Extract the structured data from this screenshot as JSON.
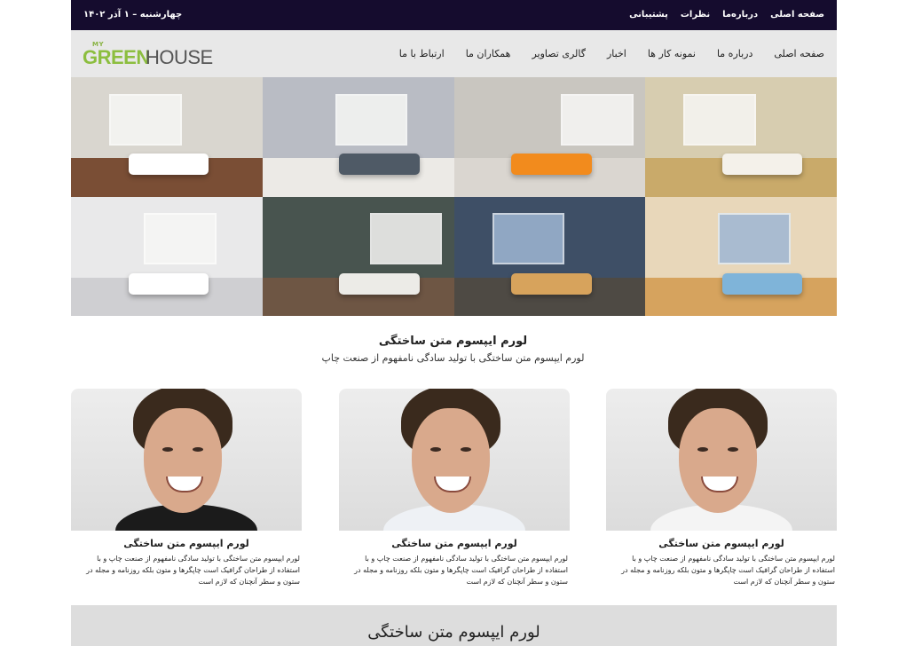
{
  "topbar": {
    "date": "چهارشنبه – ۱ آذر ۱۴۰۲",
    "links": [
      "صفحه اصلی",
      "درباره‌ما",
      "نظرات",
      "پشتیبانی"
    ]
  },
  "logo": {
    "my": "MY",
    "green": "GREEN",
    "house": "HOUSE"
  },
  "nav": [
    "صفحه اصلی",
    "درباره ما",
    "نمونه کار ها",
    "اخبار",
    "گالری تصاویر",
    "همکاران ما",
    "ارتباط با ما"
  ],
  "gallery": [
    {
      "name": "living-room-photo-1",
      "wall": "#d9d6cf",
      "floor": "#7a4e35",
      "accent": "#ffffff"
    },
    {
      "name": "living-room-photo-2",
      "wall": "#b9bcc4",
      "floor": "#eceae6",
      "accent": "#4f5a66"
    },
    {
      "name": "living-room-photo-3",
      "wall": "#c9c6c0",
      "floor": "#dad6d0",
      "accent": "#f28b1d"
    },
    {
      "name": "living-room-photo-4",
      "wall": "#d7cdb0",
      "floor": "#c9aa6a",
      "accent": "#f4f1ea"
    },
    {
      "name": "living-room-photo-5",
      "wall": "#e9e9ea",
      "floor": "#cfcfd2",
      "accent": "#ffffff"
    },
    {
      "name": "living-room-photo-6",
      "wall": "#48544f",
      "floor": "#6e5644",
      "accent": "#ecebe7"
    },
    {
      "name": "living-room-photo-7",
      "wall": "#3e4f66",
      "floor": "#4e4a44",
      "accent": "#d7a35c"
    },
    {
      "name": "living-room-photo-8",
      "wall": "#e8d7ba",
      "floor": "#d6a35e",
      "accent": "#7fb4d9"
    }
  ],
  "intro": {
    "title": "لورم ایپسوم متن ساختگی",
    "subtitle": "لورم ایپسوم متن ساختگی با تولید سادگی نامفهوم از صنعت چاپ"
  },
  "team": [
    {
      "name": "لورم ایپسوم متن ساختگی",
      "desc": "لورم ایپسوم متن ساختگی با تولید سادگی نامفهوم از صنعت چاپ و با استفاده از طراحان گرافیک است چاپگرها و متون بلکه روزنامه و مجله در ستون و سطر آنچنان که لازم است"
    },
    {
      "name": "لورم ایپسوم متن ساختگی",
      "desc": "لورم ایپسوم متن ساختگی با تولید سادگی نامفهوم از صنعت چاپ و با استفاده از طراحان گرافیک است چاپگرها و متون بلکه روزنامه و مجله در ستون و سطر آنچنان که لازم است"
    },
    {
      "name": "لورم ایپسوم متن ساختگی",
      "desc": "لورم ایپسوم متن ساختگی با تولید سادگی نامفهوم از صنعت چاپ و با استفاده از طراحان گرافیک است چاپگرها و متون بلکه روزنامه و مجله در ستون و سطر آنچنان که لازم است"
    }
  ],
  "banner": {
    "title": "لورم ایپسوم متن ساختگی"
  },
  "colors": {
    "topbar": "#150c2e",
    "header": "#e8e8e8",
    "logo_green": "#8cbe3f",
    "banner": "#dddddd"
  }
}
